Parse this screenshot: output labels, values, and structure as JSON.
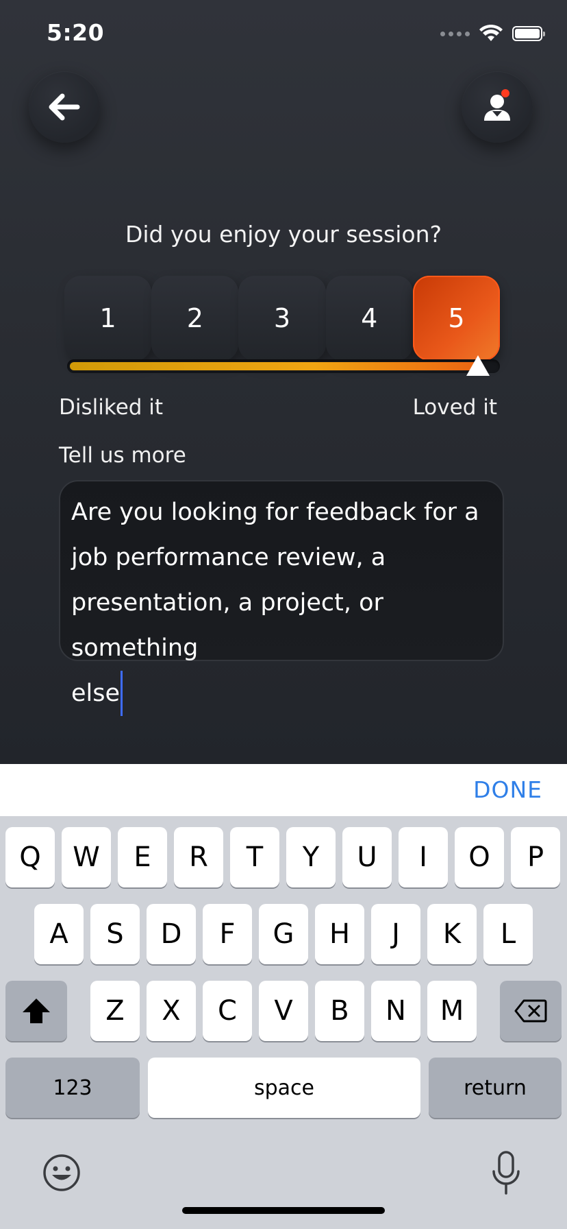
{
  "status_bar": {
    "time": "5:20"
  },
  "feedback": {
    "question": "Did you enjoy your session?",
    "rating_options": [
      "1",
      "2",
      "3",
      "4",
      "5"
    ],
    "selected_rating": 5,
    "rating_max": 5,
    "scale_min_label": "Disliked it",
    "scale_max_label": "Loved it",
    "more_label": "Tell us more",
    "text_lines": [
      "Are you looking for feedback for a",
      "job performance review, a",
      "presentation, a project, or something",
      "else"
    ]
  },
  "keyboard": {
    "accessory_done": "DONE",
    "row1": [
      "Q",
      "W",
      "E",
      "R",
      "T",
      "Y",
      "U",
      "I",
      "O",
      "P"
    ],
    "row2": [
      "A",
      "S",
      "D",
      "F",
      "G",
      "H",
      "J",
      "K",
      "L"
    ],
    "row3": [
      "Z",
      "X",
      "C",
      "V",
      "B",
      "N",
      "M"
    ],
    "numbers_label": "123",
    "space_label": "space",
    "return_label": "return"
  },
  "colors": {
    "accent_orange": "#e9581a",
    "done_blue": "#2f7fe8",
    "caret_blue": "#3e6cff",
    "notification_red": "#ff3b1f"
  }
}
